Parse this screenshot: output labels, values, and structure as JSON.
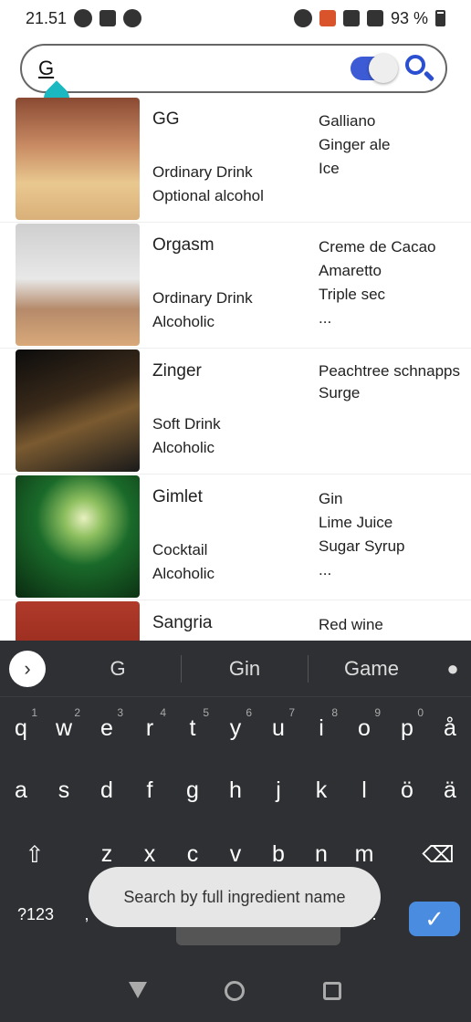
{
  "status": {
    "time": "21.51",
    "battery": "93 %"
  },
  "search": {
    "query": "G"
  },
  "drinks": [
    {
      "name": "GG",
      "category": "Ordinary Drink",
      "alcohol": "Optional alcohol",
      "ingredients": [
        "Galliano",
        "Ginger ale",
        "Ice"
      ]
    },
    {
      "name": "Orgasm",
      "category": "Ordinary Drink",
      "alcohol": "Alcoholic",
      "ingredients": [
        "Creme de Cacao",
        "Amaretto",
        "Triple sec",
        "..."
      ]
    },
    {
      "name": "Zinger",
      "category": "Soft Drink",
      "alcohol": "Alcoholic",
      "ingredients": [
        "Peachtree schnapps",
        "Surge"
      ]
    },
    {
      "name": "Gimlet",
      "category": "Cocktail",
      "alcohol": "Alcoholic",
      "ingredients": [
        "Gin",
        "Lime Juice",
        "Sugar Syrup",
        "..."
      ]
    },
    {
      "name": "Sangria",
      "category": "",
      "alcohol": "",
      "ingredients": [
        "Red wine"
      ]
    }
  ],
  "keyboard": {
    "suggestions": [
      "G",
      "Gin",
      "Game"
    ],
    "row1": [
      "q",
      "w",
      "e",
      "r",
      "t",
      "y",
      "u",
      "i",
      "o",
      "p",
      "å"
    ],
    "row1_nums": [
      "1",
      "2",
      "3",
      "4",
      "5",
      "6",
      "7",
      "8",
      "9",
      "0",
      ""
    ],
    "row2": [
      "a",
      "s",
      "d",
      "f",
      "g",
      "h",
      "j",
      "k",
      "l",
      "ö",
      "ä"
    ],
    "row3": [
      "z",
      "x",
      "c",
      "v",
      "b",
      "n",
      "m"
    ],
    "symbols_key": "?123",
    "comma": ",",
    "period": "."
  },
  "toast": {
    "text": "Search by full ingredient name"
  }
}
